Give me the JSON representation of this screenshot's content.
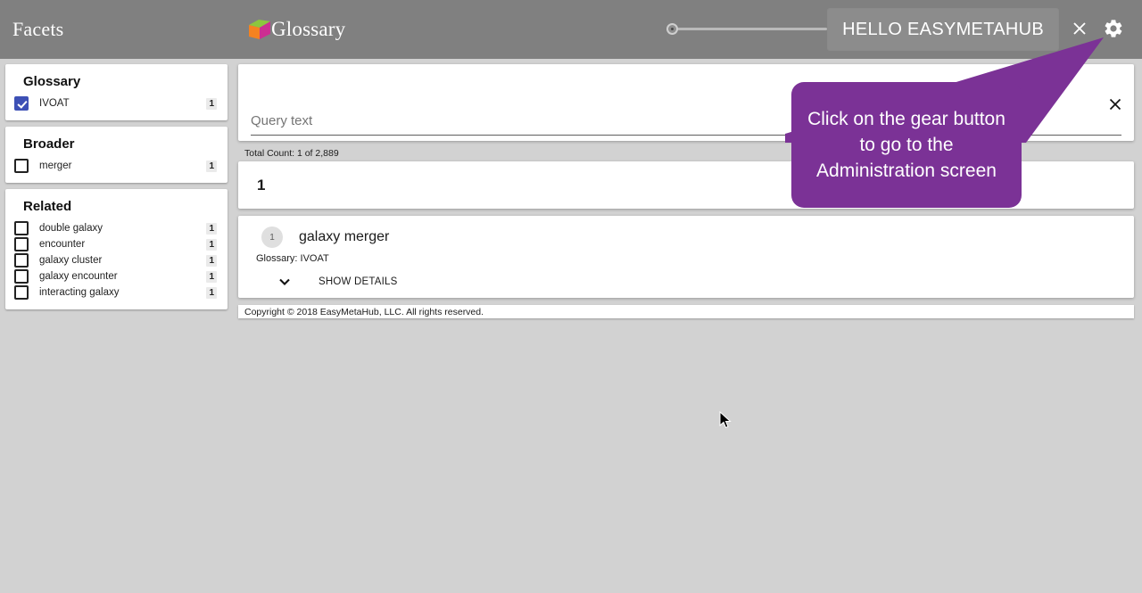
{
  "colors": {
    "header_gray": "#808080",
    "page_bg": "#d2d2d2",
    "card_white": "#ffffff",
    "tooltip_purple": "#7b3296",
    "checkbox_blue": "#3d50b5",
    "logo_green": "#8cc63e",
    "logo_orange": "#f58220",
    "logo_magenta": "#cc2e92"
  },
  "sidebar": {
    "title": "Facets",
    "panels": [
      {
        "title": "Glossary",
        "items": [
          {
            "label": "IVOAT",
            "count": "1",
            "checked": true
          }
        ]
      },
      {
        "title": "Broader",
        "items": [
          {
            "label": "merger",
            "count": "1",
            "checked": false
          }
        ]
      },
      {
        "title": "Related",
        "items": [
          {
            "label": "double galaxy",
            "count": "1",
            "checked": false
          },
          {
            "label": "encounter",
            "count": "1",
            "checked": false
          },
          {
            "label": "galaxy cluster",
            "count": "1",
            "checked": false
          },
          {
            "label": "galaxy encounter",
            "count": "1",
            "checked": false
          },
          {
            "label": "interacting galaxy",
            "count": "1",
            "checked": false
          }
        ]
      }
    ]
  },
  "header": {
    "brand": "Glossary",
    "logo_icon": "cube-logo-icon",
    "slider": {
      "name": "zoom-slider",
      "value": "0"
    },
    "hello_label": "HELLO EASYMETAHUB",
    "close_icon": "close-icon",
    "gear_icon": "gear-icon"
  },
  "query": {
    "placeholder": "Query text",
    "value": "",
    "clear_icon": "close-icon"
  },
  "results": {
    "total_count_text": "Total Count: 1 of 2,889",
    "page_number": "1",
    "items": [
      {
        "badge": "1",
        "title": "galaxy merger",
        "subtitle": "Glossary: IVOAT",
        "details_label": "SHOW DETAILS",
        "chevron_icon": "chevron-down-icon"
      }
    ]
  },
  "footer": {
    "copyright": "Copyright © 2018 EasyMetaHub, LLC. All rights reserved."
  },
  "tooltip": {
    "text": "Click on the gear button to go to the Administration screen"
  }
}
